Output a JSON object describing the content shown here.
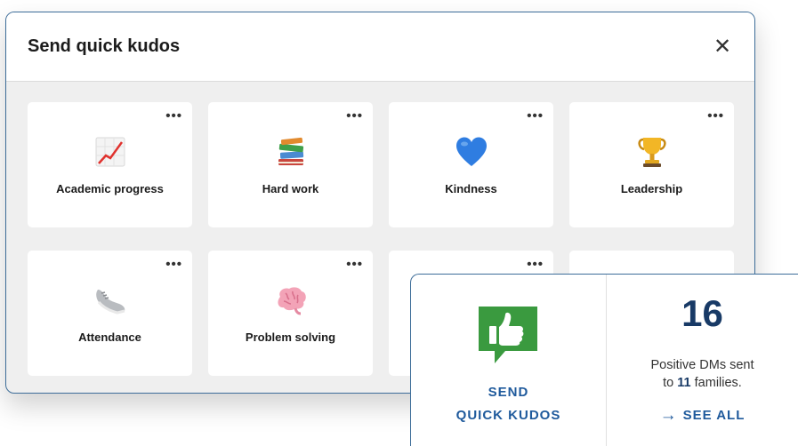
{
  "modal": {
    "title": "Send quick kudos",
    "close_icon": "close-icon",
    "more_label": "•••",
    "cards": [
      {
        "label": "Academic progress",
        "icon": "chart-increasing-icon"
      },
      {
        "label": "Hard work",
        "icon": "books-icon"
      },
      {
        "label": "Kindness",
        "icon": "blue-heart-icon"
      },
      {
        "label": "Leadership",
        "icon": "trophy-icon"
      },
      {
        "label": "Attendance",
        "icon": "sneaker-icon"
      },
      {
        "label": "Problem solving",
        "icon": "brain-icon"
      }
    ]
  },
  "promo": {
    "send_line1": "SEND",
    "send_line2": "QUICK KUDOS",
    "count": "16",
    "dm_line1": "Positive DMs sent",
    "dm_prefix": "to ",
    "families": "11",
    "dm_suffix": " families.",
    "see_all": "SEE ALL",
    "colors": {
      "accent": "#1f5a9c",
      "count": "#183a66",
      "thumb_bubble": "#3a9a3f"
    }
  }
}
